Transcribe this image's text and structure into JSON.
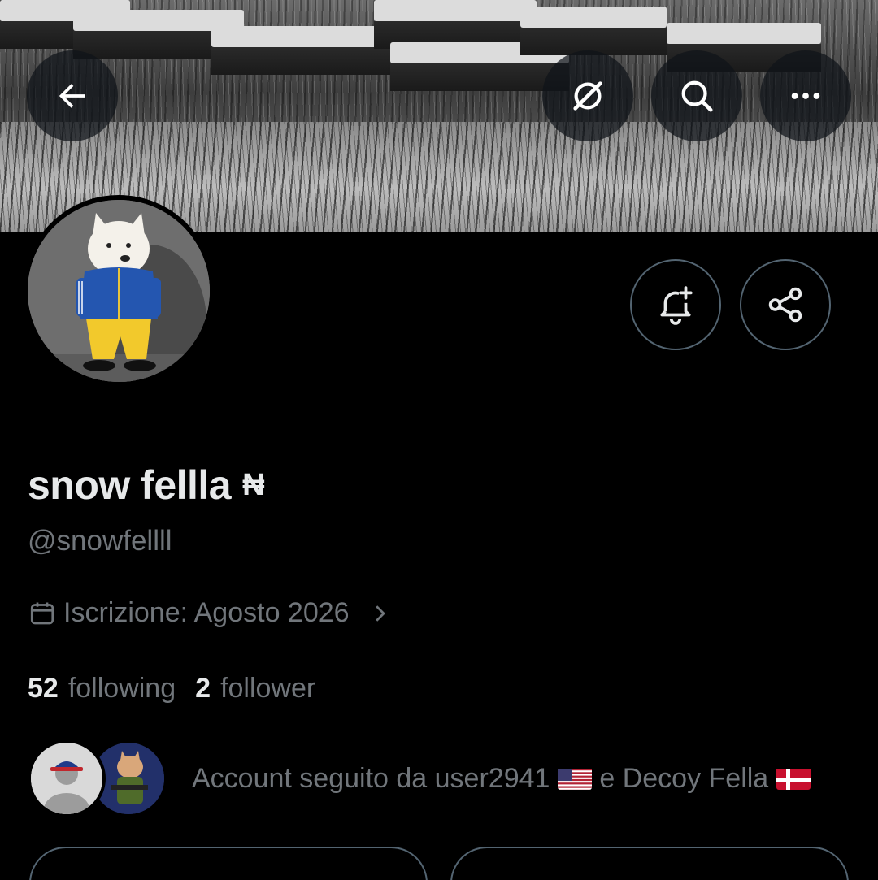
{
  "header": {
    "back_icon": "arrow-left-icon",
    "grok_icon": "grok-slash-icon",
    "search_icon": "search-icon",
    "more_icon": "more-horizontal-icon"
  },
  "profile": {
    "display_name": "snow fellla",
    "name_glyph": "₦",
    "handle": "@snowfellll",
    "joined": "Iscrizione: Agosto 2026",
    "following_count": "52",
    "following_label": "following",
    "followers_count": "2",
    "followers_label": "follower"
  },
  "actions": {
    "notify_icon": "bell-plus-icon",
    "share_icon": "share-icon"
  },
  "followed_by": {
    "text_prefix": "Account seguito da user2941",
    "text_mid": "e Decoy Fella",
    "flag_1": "us-flag",
    "flag_2": "dk-flag"
  },
  "colors": {
    "background": "#000000",
    "primary_text": "#e7e9ea",
    "secondary_text": "#71767b",
    "border": "#536471"
  }
}
